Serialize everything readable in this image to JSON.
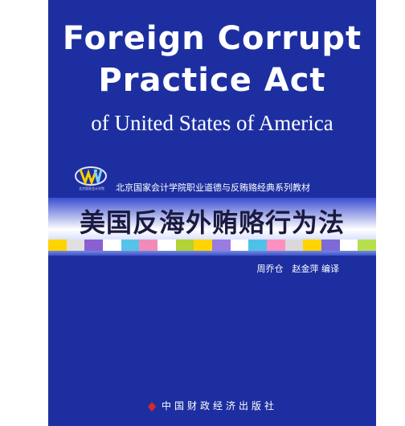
{
  "cover": {
    "title_line_1": "Foreign Corrupt",
    "title_line_2": "Practice Act",
    "subtitle": "of United States of America",
    "series": "北京国家会计学院职业道德与反贿赂经典系列教材",
    "logo_caption": "北京国家会计学院",
    "chinese_title": "美国反海外贿赂行为法",
    "authors": "周乔仓　赵金萍 编译",
    "publisher": "中国财政经济出版社",
    "colors": {
      "background": "#1d2fa0",
      "title_text": "#ffffff",
      "chinese_title_text": "#1a1a40",
      "stripe": [
        "#ffd400",
        "#e0e0e0",
        "#8b5fd3",
        "#ffffff",
        "#56c4e8",
        "#f28bb8",
        "#ffffff",
        "#b2d235",
        "#ffd400",
        "#9a7be0",
        "#ffffff",
        "#4fc1e9",
        "#ff8fc1",
        "#d9d9d9",
        "#ffd400",
        "#7d6ad8",
        "#ffffff",
        "#b7e04f"
      ]
    }
  }
}
